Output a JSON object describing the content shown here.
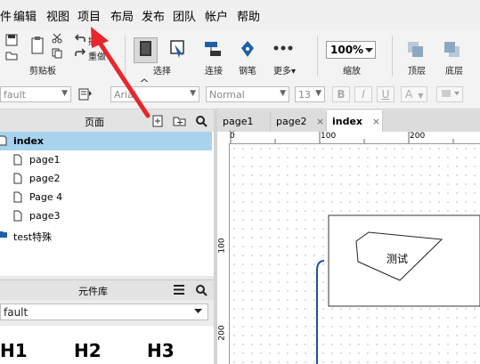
{
  "menubar": {
    "items": [
      {
        "label": "件"
      },
      {
        "label": "编辑"
      },
      {
        "label": "视图"
      },
      {
        "label": "项目"
      },
      {
        "label": "布局"
      },
      {
        "label": "发布"
      },
      {
        "label": "团队"
      },
      {
        "label": "帐户"
      },
      {
        "label": "帮助"
      }
    ]
  },
  "toolbar": {
    "clipboard_label": "剪贴板",
    "undo_label": "撤",
    "redo_label": "重做",
    "select_label": "选择",
    "connect_label": "连接",
    "pen_label": "钢笔",
    "more_label": "更多▾",
    "zoom_value": "100%",
    "zoom_label": "缩放",
    "top_layer_label": "顶层",
    "bottom_layer_label": "底层"
  },
  "formatbar": {
    "style_value": "fault",
    "font_value": "Arial",
    "weight_value": "Normal",
    "size_value": "13",
    "bold": "B",
    "italic": "I",
    "underline": "U",
    "font_color": "A"
  },
  "pages_panel": {
    "title": "页面",
    "pages": [
      {
        "label": "index",
        "selected": true
      },
      {
        "label": "page1"
      },
      {
        "label": "page2"
      },
      {
        "label": "Page 4"
      },
      {
        "label": "page3"
      }
    ],
    "folder": {
      "label": "test特殊"
    }
  },
  "library_panel": {
    "title": "元件库",
    "library_value": "fault",
    "widgets": [
      {
        "label": "H1"
      },
      {
        "label": "H2"
      },
      {
        "label": "H3"
      }
    ]
  },
  "tabs": [
    {
      "label": "page1",
      "close": "×"
    },
    {
      "label": "page2",
      "close": "×"
    },
    {
      "label": "index",
      "close": "×",
      "active": true
    }
  ],
  "ruler": {
    "h_ticks": [
      "0",
      "100",
      "200"
    ],
    "v_ticks": [
      "100",
      "200"
    ]
  },
  "canvas": {
    "shape_text": "测试"
  },
  "colors": {
    "selected_row": "#a7d3ef",
    "annotation_arrow": "#e8262b",
    "icon_blue": "#1f5fa8"
  }
}
